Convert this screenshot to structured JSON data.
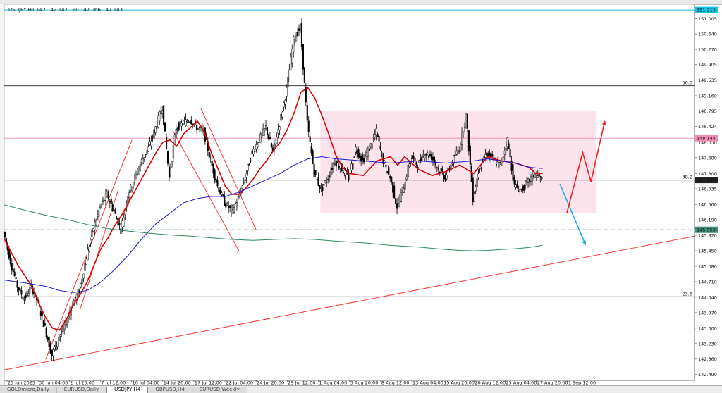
{
  "window": {
    "symbol_info": "USDJPY,H1 147.142 147.190 147.066 147.143"
  },
  "tabs": [
    {
      "label": "GOLDmicro,Daily",
      "active": false
    },
    {
      "label": "EURUSD,Daily",
      "active": false
    },
    {
      "label": "USDJPY,H4",
      "active": true
    },
    {
      "label": "GBPUSD,H4",
      "active": false
    },
    {
      "label": "EURUSD,Weekly",
      "active": false
    }
  ],
  "chart_data": {
    "type": "line",
    "symbol": "USDJPY",
    "timeframe": "H1",
    "y_ticks": [
      "151.005",
      "150.640",
      "150.270",
      "149.905",
      "149.535",
      "149.160",
      "148.795",
      "148.424",
      "148.050",
      "147.680",
      "147.300",
      "146.935",
      "146.560",
      "146.190",
      "145.820",
      "145.450",
      "145.080",
      "144.710",
      "144.340",
      "143.970",
      "143.600",
      "143.230",
      "142.860",
      "142.490"
    ],
    "ylim": [
      142.35,
      151.35
    ],
    "x_ticks": [
      "25 Jun 2025",
      "30 Jun 04:00",
      "2 Jul 20:00",
      "7 Jul 12:00",
      "10 Jul 04:00",
      "14 Jul 20:00",
      "17 Jul 12:00",
      "22 Jul 04:00",
      "24 Jul 20:00",
      "29 Jul 12:00",
      "1 Aug 04:00",
      "5 Aug 20:00",
      "8 Aug 12:00",
      "13 Aug 04:00",
      "15 Aug 20:00",
      "20 Aug 12:00",
      "25 Aug 04:00",
      "27 Aug 20:00",
      "1 Sep 12:00"
    ],
    "xlim": [
      0,
      100
    ],
    "price_labels": [
      {
        "price": 151.213,
        "text": "151.213",
        "color": "#17c2e4"
      },
      {
        "price": 148.144,
        "text": "148.144",
        "color": "#f08bb6"
      },
      {
        "price": 147.143,
        "text": "147.143",
        "color": "#222222"
      },
      {
        "price": 145.953,
        "text": "145.953",
        "color": "#3f8f7a"
      }
    ],
    "fib_levels": [
      {
        "price": 149.4,
        "label": "50.0"
      },
      {
        "price": 147.143,
        "label": "38.2"
      },
      {
        "price": 144.35,
        "label": "23.6"
      }
    ],
    "series": [
      {
        "color": "#e00000",
        "points": [
          [
            0,
            145.74
          ],
          [
            2,
            145.1
          ],
          [
            4,
            144.6
          ],
          [
            5,
            144.2
          ],
          [
            6,
            143.85
          ],
          [
            7,
            143.6
          ],
          [
            8,
            143.55
          ],
          [
            9,
            143.8
          ],
          [
            10,
            144.15
          ],
          [
            11,
            144.4
          ],
          [
            12,
            144.7
          ],
          [
            13,
            145.1
          ],
          [
            14,
            145.5
          ],
          [
            15,
            145.75
          ],
          [
            16,
            146.05
          ],
          [
            17,
            146.3
          ],
          [
            18,
            146.6
          ],
          [
            19,
            146.9
          ],
          [
            20,
            147.2
          ],
          [
            21,
            147.5
          ],
          [
            22,
            147.8
          ],
          [
            23,
            148.05
          ],
          [
            24,
            148.1
          ],
          [
            25,
            147.95
          ],
          [
            26,
            148.25
          ],
          [
            27,
            148.4
          ],
          [
            28,
            148.55
          ],
          [
            29,
            148.3
          ],
          [
            30,
            147.8
          ],
          [
            31,
            147.4
          ],
          [
            32,
            147.0
          ],
          [
            33,
            146.8
          ],
          [
            34,
            146.8
          ],
          [
            35,
            146.95
          ],
          [
            36,
            147.15
          ],
          [
            37,
            147.4
          ],
          [
            38,
            147.6
          ],
          [
            39,
            147.85
          ],
          [
            40,
            148.05
          ],
          [
            41,
            148.35
          ],
          [
            42,
            148.75
          ],
          [
            43,
            149.25
          ],
          [
            44,
            149.35
          ],
          [
            45,
            149.1
          ],
          [
            46,
            148.7
          ],
          [
            47,
            148.25
          ],
          [
            48,
            147.75
          ],
          [
            49,
            147.45
          ],
          [
            50,
            147.3
          ],
          [
            52,
            147.25
          ],
          [
            54,
            147.6
          ],
          [
            56,
            147.7
          ],
          [
            57,
            147.5
          ],
          [
            58,
            147.7
          ],
          [
            60,
            147.4
          ],
          [
            62,
            147.25
          ],
          [
            64,
            147.35
          ],
          [
            66,
            147.5
          ],
          [
            68,
            147.3
          ],
          [
            70,
            147.7
          ],
          [
            72,
            147.6
          ],
          [
            74,
            147.55
          ],
          [
            76,
            147.45
          ],
          [
            77,
            147.3
          ],
          [
            78,
            147.3
          ]
        ]
      },
      {
        "color": "#1a1ad0",
        "points": [
          [
            0,
            144.75
          ],
          [
            3,
            144.68
          ],
          [
            6,
            144.6
          ],
          [
            8,
            144.5
          ],
          [
            10,
            144.45
          ],
          [
            12,
            144.5
          ],
          [
            14,
            144.7
          ],
          [
            16,
            145.0
          ],
          [
            18,
            145.35
          ],
          [
            20,
            145.75
          ],
          [
            22,
            146.1
          ],
          [
            24,
            146.35
          ],
          [
            26,
            146.6
          ],
          [
            28,
            146.7
          ],
          [
            30,
            146.75
          ],
          [
            32,
            146.75
          ],
          [
            34,
            146.85
          ],
          [
            36,
            147.0
          ],
          [
            38,
            147.15
          ],
          [
            40,
            147.3
          ],
          [
            42,
            147.5
          ],
          [
            44,
            147.65
          ],
          [
            46,
            147.7
          ],
          [
            48,
            147.65
          ],
          [
            52,
            147.6
          ],
          [
            56,
            147.55
          ],
          [
            60,
            147.6
          ],
          [
            64,
            147.55
          ],
          [
            68,
            147.6
          ],
          [
            70,
            147.65
          ],
          [
            72,
            147.6
          ],
          [
            74,
            147.55
          ],
          [
            76,
            147.45
          ],
          [
            78,
            147.42
          ]
        ]
      },
      {
        "color": "#2e8a5c",
        "points": [
          [
            0,
            146.55
          ],
          [
            3,
            146.42
          ],
          [
            6,
            146.3
          ],
          [
            9,
            146.2
          ],
          [
            12,
            146.08
          ],
          [
            15,
            145.98
          ],
          [
            18,
            145.92
          ],
          [
            21,
            145.87
          ],
          [
            24,
            145.83
          ],
          [
            27,
            145.8
          ],
          [
            30,
            145.76
          ],
          [
            33,
            145.72
          ],
          [
            36,
            145.7
          ],
          [
            39,
            145.72
          ],
          [
            42,
            145.74
          ],
          [
            45,
            145.72
          ],
          [
            48,
            145.68
          ],
          [
            52,
            145.64
          ],
          [
            56,
            145.58
          ],
          [
            60,
            145.54
          ],
          [
            64,
            145.48
          ],
          [
            66,
            145.46
          ],
          [
            68,
            145.45
          ],
          [
            70,
            145.46
          ],
          [
            72,
            145.48
          ],
          [
            74,
            145.5
          ],
          [
            76,
            145.53
          ],
          [
            78,
            145.58
          ]
        ]
      }
    ],
    "price_path": [
      [
        0,
        145.9
      ],
      [
        1,
        145.2
      ],
      [
        2,
        144.6
      ],
      [
        3,
        144.3
      ],
      [
        4,
        144.6
      ],
      [
        5,
        144.2
      ],
      [
        6,
        143.6
      ],
      [
        7,
        142.95
      ],
      [
        8,
        143.4
      ],
      [
        9,
        143.7
      ],
      [
        10,
        144.2
      ],
      [
        11,
        144.5
      ],
      [
        12,
        145.3
      ],
      [
        13,
        146.0
      ],
      [
        14,
        146.5
      ],
      [
        15,
        146.8
      ],
      [
        16,
        146.4
      ],
      [
        17,
        145.95
      ],
      [
        18,
        146.8
      ],
      [
        19,
        147.2
      ],
      [
        20,
        147.6
      ],
      [
        21,
        147.9
      ],
      [
        22,
        148.4
      ],
      [
        23,
        148.9
      ],
      [
        24,
        147.2
      ],
      [
        25,
        148.4
      ],
      [
        26,
        148.5
      ],
      [
        27,
        148.6
      ],
      [
        28,
        148.4
      ],
      [
        29,
        148.3
      ],
      [
        30,
        147.6
      ],
      [
        31,
        147.0
      ],
      [
        32,
        146.6
      ],
      [
        33,
        146.4
      ],
      [
        34,
        146.7
      ],
      [
        35,
        147.2
      ],
      [
        36,
        147.8
      ],
      [
        37,
        148.1
      ],
      [
        38,
        148.4
      ],
      [
        39,
        147.8
      ],
      [
        40,
        148.5
      ],
      [
        41,
        149.3
      ],
      [
        42,
        150.5
      ],
      [
        43,
        150.8
      ],
      [
        44,
        148.5
      ],
      [
        45,
        147.3
      ],
      [
        46,
        146.9
      ],
      [
        47,
        147.2
      ],
      [
        48,
        147.6
      ],
      [
        49,
        147.4
      ],
      [
        50,
        147.2
      ],
      [
        51,
        147.9
      ],
      [
        52,
        147.6
      ],
      [
        53,
        147.9
      ],
      [
        54,
        148.3
      ],
      [
        55,
        147.6
      ],
      [
        56,
        147.2
      ],
      [
        57,
        146.5
      ],
      [
        58,
        147.0
      ],
      [
        59,
        147.7
      ],
      [
        60,
        147.5
      ],
      [
        61,
        147.8
      ],
      [
        62,
        147.7
      ],
      [
        63,
        147.4
      ],
      [
        64,
        147.2
      ],
      [
        65,
        147.6
      ],
      [
        66,
        147.9
      ],
      [
        67,
        148.7
      ],
      [
        68,
        146.7
      ],
      [
        69,
        147.5
      ],
      [
        70,
        147.8
      ],
      [
        71,
        147.6
      ],
      [
        72,
        147.5
      ],
      [
        73,
        148.1
      ],
      [
        74,
        147.0
      ],
      [
        75,
        146.9
      ],
      [
        76,
        147.1
      ],
      [
        77,
        147.3
      ],
      [
        78,
        147.143
      ]
    ],
    "zone": {
      "x0": 45.8,
      "x1": 85.7,
      "y_top": 148.8,
      "y_bottom": 146.35,
      "color": "#fce3ec"
    },
    "trendlines": [
      {
        "color": "#ff2020",
        "points": [
          [
            0,
            142.6
          ],
          [
            100,
            145.8
          ]
        ]
      },
      {
        "color": "#ff2020",
        "points": [
          [
            6,
            142.85
          ],
          [
            18.5,
            148.1
          ]
        ]
      },
      {
        "color": "#ff2020",
        "points": [
          [
            11,
            144.05
          ],
          [
            16.5,
            146.9
          ]
        ]
      },
      {
        "color": "#ff2020",
        "points": [
          [
            24.5,
            148.3
          ],
          [
            34,
            145.45
          ]
        ]
      },
      {
        "color": "#ff2020",
        "points": [
          [
            28.5,
            148.85
          ],
          [
            36.5,
            145.95
          ]
        ]
      }
    ],
    "forecast_arrows": [
      {
        "color": "#1aa8ea",
        "points": [
          [
            80.5,
            147.05
          ],
          [
            84.2,
            145.6
          ]
        ]
      },
      {
        "color": "#ff1a1a",
        "points": [
          [
            81.5,
            146.35
          ],
          [
            83.8,
            147.8
          ],
          [
            85,
            147.1
          ],
          [
            87,
            148.55
          ]
        ]
      }
    ]
  }
}
